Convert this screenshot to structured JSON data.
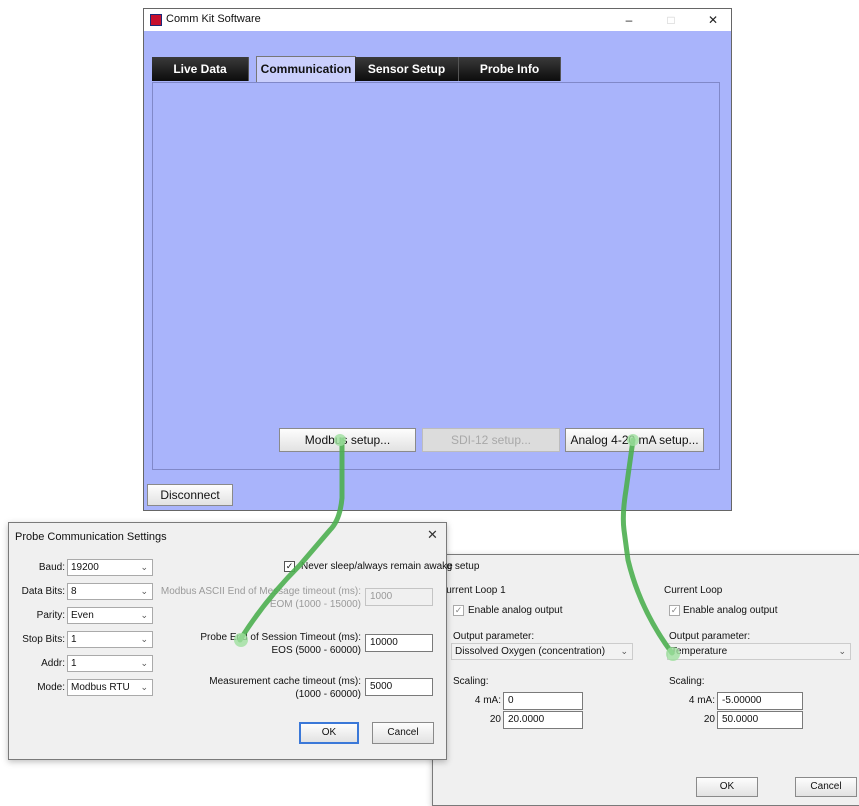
{
  "main_window": {
    "title": "Comm Kit Software",
    "controls": {
      "minimize": "–",
      "maximize": "□",
      "close": "✕"
    },
    "tabs": [
      "Live Data",
      "Communication",
      "Sensor Setup",
      "Probe Info"
    ],
    "active_tab": "Communication",
    "buttons": {
      "modbus": "Modbus setup...",
      "sdi12": "SDI-12 setup...",
      "analog": "Analog 4-20 mA setup..."
    },
    "disconnect": "Disconnect"
  },
  "probe_dialog": {
    "title": "Probe Communication Settings",
    "close": "✕",
    "fields": {
      "baud": {
        "label": "Baud:",
        "value": "19200"
      },
      "data_bits": {
        "label": "Data Bits:",
        "value": "8"
      },
      "parity": {
        "label": "Parity:",
        "value": "Even"
      },
      "stop_bits": {
        "label": "Stop Bits:",
        "value": "1"
      },
      "addr": {
        "label": "Addr:",
        "value": "1"
      },
      "mode": {
        "label": "Mode:",
        "value": "Modbus RTU"
      }
    },
    "never_sleep": "Never sleep/always remain awake",
    "ascii_timeout": {
      "line1": "Modbus ASCII End of Message timeout (ms):",
      "line2": "EOM (1000 - 15000)",
      "value": "1000"
    },
    "eos_timeout": {
      "line1": "Probe End of Session Timeout (ms):",
      "line2": "EOS (5000 - 60000)",
      "value": "10000"
    },
    "cache_timeout": {
      "line1": "Measurement cache timeout (ms):",
      "line2": "(1000 - 60000)",
      "value": "5000"
    },
    "ok": "OK",
    "cancel": "Cancel"
  },
  "analog_dialog": {
    "title": "Analog setup",
    "loop1": {
      "title": "Current Loop 1",
      "enable": "Enable analog output",
      "output_label": "Output parameter:",
      "output_value": "Dissolved Oxygen (concentration)",
      "scaling": "Scaling:",
      "ma4_label": "4 mA:",
      "ma4_value": "0",
      "ma20_label": "20",
      "ma20_value": "20.0000"
    },
    "loop2": {
      "title": "Current Loop",
      "enable": "Enable analog output",
      "output_label": "Output parameter:",
      "output_value": "Temperature",
      "scaling": "Scaling:",
      "ma4_label": "4 mA:",
      "ma4_value": "-5.00000",
      "ma20_label": "20",
      "ma20_value": "50.0000"
    },
    "ok": "OK",
    "cancel": "Cancel"
  },
  "colors": {
    "window_bg": "#a9b4fb",
    "connector": "#4caf50"
  }
}
